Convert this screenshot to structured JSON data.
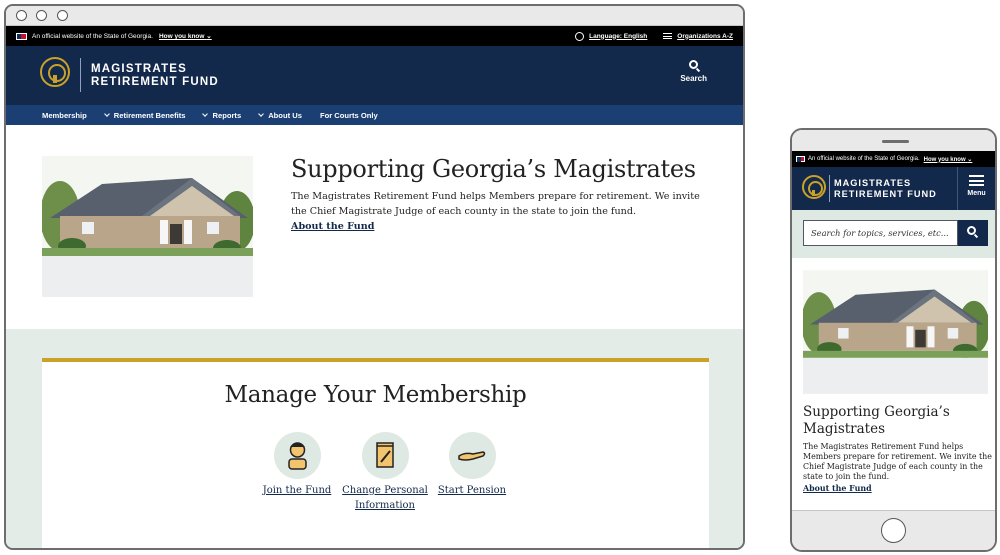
{
  "banner": {
    "official_text": "An official website of the State of Georgia.",
    "how_you_know": "How you know",
    "language": "Language: English",
    "organizations": "Organizations A-Z"
  },
  "header": {
    "brand_line1": "MAGISTRATES",
    "brand_line2": "RETIREMENT FUND",
    "search_label": "Search",
    "menu_label": "Menu"
  },
  "nav": {
    "items": [
      {
        "label": "Membership",
        "has_dropdown": false
      },
      {
        "label": "Retirement Benefits",
        "has_dropdown": true
      },
      {
        "label": "Reports",
        "has_dropdown": true
      },
      {
        "label": "About Us",
        "has_dropdown": true
      },
      {
        "label": "For Courts Only",
        "has_dropdown": false
      }
    ]
  },
  "hero": {
    "title": "Supporting Georgia’s Magistrates",
    "description": "The Magistrates Retirement Fund helps Members prepare for retirement. We invite the Chief Magistrate Judge of each county in the state to join the fund.",
    "link": "About the Fund"
  },
  "membership": {
    "title": "Manage Your Membership",
    "actions": [
      {
        "label": "Join the Fund",
        "icon": "person-icon"
      },
      {
        "label": "Change Personal Information",
        "icon": "notepad-icon"
      },
      {
        "label": "Start Pension",
        "icon": "hand-icon"
      }
    ]
  },
  "mobile": {
    "search_placeholder": "Search for topics, services, etc..."
  },
  "colors": {
    "navy": "#13294b",
    "nav_blue": "#1c3f73",
    "gold": "#c9a227",
    "mint": "#e3ece6"
  }
}
